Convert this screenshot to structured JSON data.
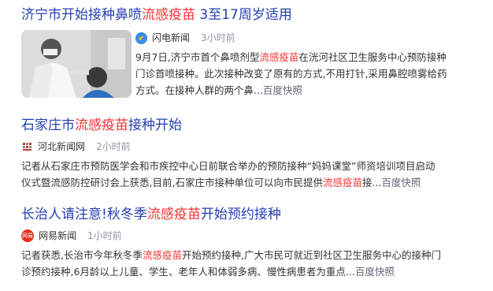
{
  "results": [
    {
      "title_pre": "济宁市开始接种鼻喷",
      "title_hl": "流感疫苗",
      "title_post": " 3至17周岁适用",
      "source": "闪电新闻",
      "time": "3小时前",
      "snippet_line1_pre": "9月7日,济宁市首个鼻喷剂型",
      "snippet_line1_hl": "流感疫苗",
      "snippet_line1_post": "在洸河社区卫生服务中心预防接种",
      "snippet_line2": "门诊首喷接种。此次接种改变了原有的方式,不用打针,采用鼻腔喷雾给药",
      "snippet_line3": "方式。在接种人群的两个鼻...",
      "snapshot": "百度快照"
    },
    {
      "title_pre": "石家庄市",
      "title_hl": "流感疫苗",
      "title_post": "接种开始",
      "source": "河北新闻网",
      "time": "2小时前",
      "snippet_line1": "记者从石家庄市预防医学会和市疾控中心日前联合举办的预防接种“妈妈课堂”师资培训项目启动",
      "snippet_line2_pre": "仪式暨流感防控研讨会上获悉,目前,石家庄市接种单位可以向市民提供",
      "snippet_line2_hl": "流感疫苗",
      "snippet_line2_post": "接...",
      "snapshot": "百度快照"
    },
    {
      "title_pre": "长治人请注意!秋冬季",
      "title_hl": "流感疫苗",
      "title_post": "开始预约接种",
      "source": "网易新闻",
      "source_icon_text": "网易",
      "time": "1小时前",
      "snippet_line1_pre": "记者获悉,长治市今年秋冬季",
      "snippet_line1_hl": "流感疫苗",
      "snippet_line1_post": "开始预约接种,广大市民可就近到社区卫生服务中心的接种门",
      "snippet_line2": "诊预约接种,6月龄以上儿童、学生、老年人和体弱多病、慢性病患者为重点...",
      "snapshot": "百度快照"
    }
  ],
  "colors": {
    "title": "#2440b3",
    "highlight": "#f73131",
    "time": "#9195a3"
  },
  "icons": [
    "shandian-news-icon",
    "hebei-news-icon",
    "netease-news-icon"
  ]
}
